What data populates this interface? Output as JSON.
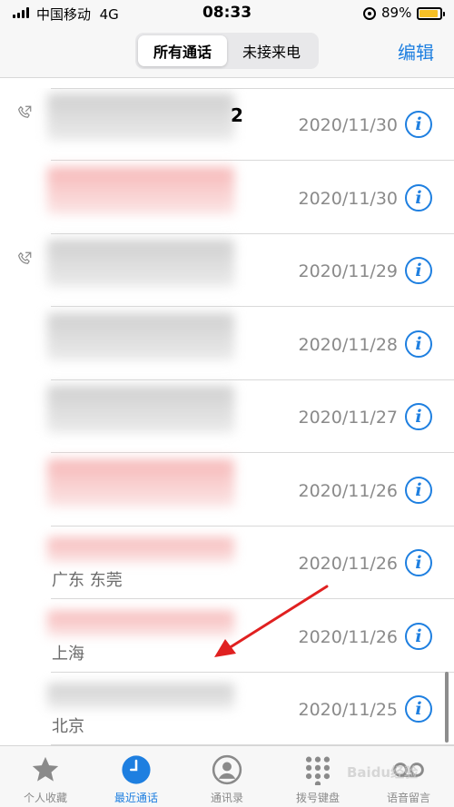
{
  "status_bar": {
    "carrier": "中国移动",
    "network": "4G",
    "time": "08:33",
    "battery": "89%",
    "battery_level": 0.89
  },
  "nav": {
    "segments": [
      "所有通话",
      "未接来电"
    ],
    "active_segment": 0,
    "edit_label": "编辑"
  },
  "calls": [
    {
      "name_tail": "2",
      "location": "",
      "date": "2020/11/30",
      "outgoing": true,
      "name_style": "gray"
    },
    {
      "name_tail": "",
      "location": "",
      "date": "2020/11/30",
      "outgoing": false,
      "name_style": "red"
    },
    {
      "name_tail": "",
      "location": "",
      "date": "2020/11/29",
      "outgoing": true,
      "name_style": "gray"
    },
    {
      "name_tail": "",
      "location": "",
      "date": "2020/11/28",
      "outgoing": false,
      "name_style": "gray"
    },
    {
      "name_tail": "",
      "location": "",
      "date": "2020/11/27",
      "outgoing": false,
      "name_style": "gray"
    },
    {
      "name_tail": "",
      "location": "",
      "date": "2020/11/26",
      "outgoing": false,
      "name_style": "red"
    },
    {
      "name_tail": "",
      "location": "广东 东莞",
      "date": "2020/11/26",
      "outgoing": false,
      "name_style": "red"
    },
    {
      "name_tail": "",
      "location": "上海",
      "date": "2020/11/26",
      "outgoing": false,
      "name_style": "red"
    },
    {
      "name_tail": "",
      "location": "北京",
      "date": "2020/11/25",
      "outgoing": false,
      "name_style": "gray"
    }
  ],
  "tabs": [
    {
      "label": "个人收藏",
      "icon": "star-icon"
    },
    {
      "label": "最近通话",
      "icon": "clock-icon"
    },
    {
      "label": "通讯录",
      "icon": "contact-icon"
    },
    {
      "label": "拨号键盘",
      "icon": "keypad-icon"
    },
    {
      "label": "语音留言",
      "icon": "voicemail-icon"
    }
  ],
  "active_tab": 1,
  "accent_color": "#1e7fe0",
  "annotation_color": "#e02020",
  "watermark": "Baidu经验"
}
